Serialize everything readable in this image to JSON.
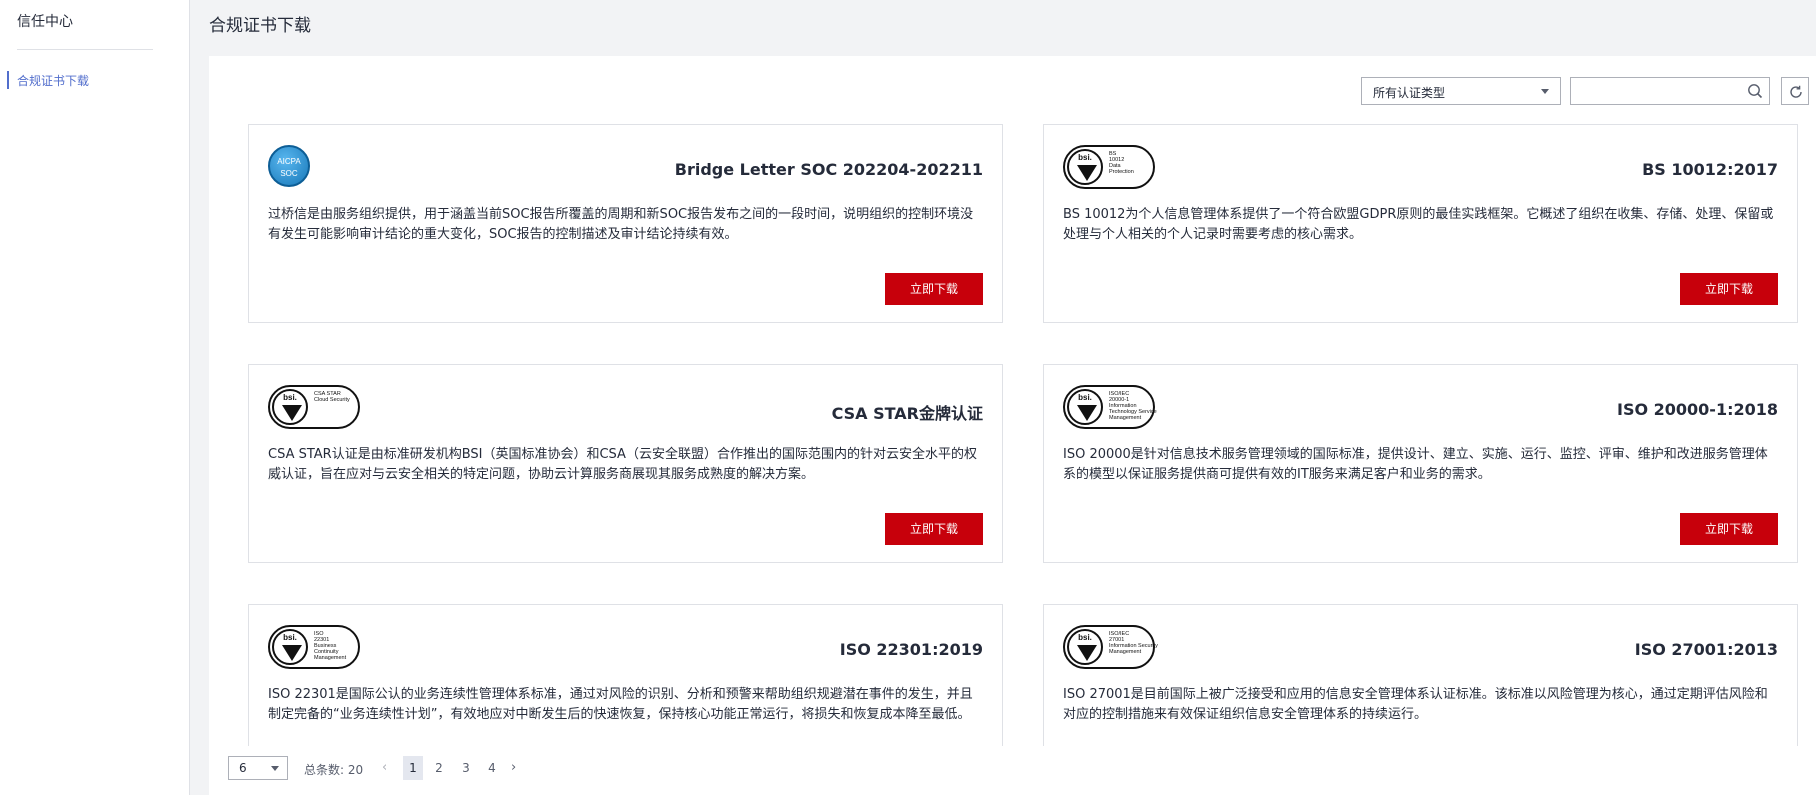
{
  "sidebar": {
    "title": "信任中心",
    "items": [
      {
        "label": "合规证书下载",
        "active": true
      }
    ]
  },
  "page": {
    "title": "合规证书下载"
  },
  "toolbar": {
    "filter_value": "所有认证类型",
    "search_placeholder": "",
    "refresh_icon": "refresh-icon",
    "search_icon": "search-icon"
  },
  "download_label": "立即下载",
  "cards": [
    {
      "name": "Bridge Letter SOC 202204-202211",
      "logo": {
        "type": "aicpa",
        "line1": "AICPA",
        "line2": "SOC"
      },
      "desc": "过桥信是由服务组织提供，用于涵盖当前SOC报告所覆盖的周期和新SOC报告发布之间的一段时间，说明组织的控制环境没有发生可能影响审计结论的重大变化，SOC报告的控制描述及审计结论持续有效。"
    },
    {
      "name": "BS 10012:2017",
      "logo": {
        "type": "bsi",
        "mark": "bsi.",
        "lines": [
          "BS",
          "10012",
          "Data",
          "Protection"
        ]
      },
      "desc": "BS 10012为个人信息管理体系提供了一个符合欧盟GDPR原则的最佳实践框架。它概述了组织在收集、存储、处理、保留或处理与个人相关的个人记录时需要考虑的核心需求。"
    },
    {
      "name": "CSA STAR金牌认证",
      "logo": {
        "type": "bsi",
        "mark": "bsi.",
        "lines": [
          "CSA STAR",
          "Cloud Security"
        ]
      },
      "desc": "CSA STAR认证是由标准研发机构BSI（英国标准协会）和CSA（云安全联盟）合作推出的国际范围内的针对云安全水平的权威认证，旨在应对与云安全相关的特定问题，协助云计算服务商展现其服务成熟度的解决方案。"
    },
    {
      "name": "ISO 20000-1:2018",
      "logo": {
        "type": "bsi",
        "mark": "bsi.",
        "lines": [
          "ISO/IEC",
          "20000-1",
          "Information",
          "Technology Service",
          "Management"
        ]
      },
      "desc": "ISO 20000是针对信息技术服务管理领域的国际标准，提供设计、建立、实施、运行、监控、评审、维护和改进服务管理体系的模型以保证服务提供商可提供有效的IT服务来满足客户和业务的需求。"
    },
    {
      "name": "ISO 22301:2019",
      "logo": {
        "type": "bsi",
        "mark": "bsi.",
        "lines": [
          "ISO",
          "22301",
          "Business",
          "Continuity",
          "Management"
        ]
      },
      "desc": "ISO 22301是国际公认的业务连续性管理体系标准，通过对风险的识别、分析和预警来帮助组织规避潜在事件的发生，并且制定完备的“业务连续性计划”，有效地应对中断发生后的快速恢复，保持核心功能正常运行，将损失和恢复成本降至最低。"
    },
    {
      "name": "ISO 27001:2013",
      "logo": {
        "type": "bsi",
        "mark": "bsi.",
        "lines": [
          "ISO/IEC",
          "27001",
          "Information Security",
          "Management"
        ]
      },
      "desc": "ISO 27001是目前国际上被广泛接受和应用的信息安全管理体系认证标准。该标准以风险管理为核心，通过定期评估风险和对应的控制措施来有效保证组织信息安全管理体系的持续运行。"
    }
  ],
  "pagination": {
    "page_size": "6",
    "total": "总条数: 20",
    "pages": [
      "1",
      "2",
      "3",
      "4"
    ],
    "current": "1",
    "prev_icon": "chevron-left-icon",
    "next_icon": "chevron-right-icon"
  }
}
